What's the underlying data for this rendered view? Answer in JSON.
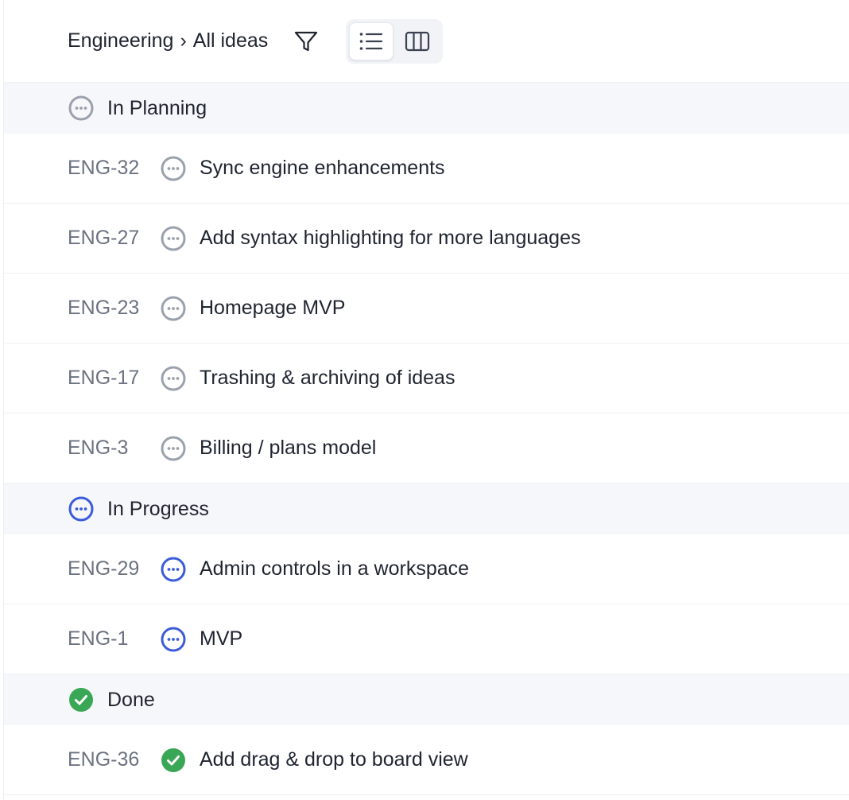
{
  "header": {
    "breadcrumb_team": "Engineering",
    "breadcrumb_sep": "›",
    "breadcrumb_view": "All ideas",
    "filter_icon": "filter-icon",
    "view_list_icon": "list-view-icon",
    "view_board_icon": "board-view-icon",
    "active_view": "list"
  },
  "colors": {
    "planning": "#9aa1ad",
    "progress": "#3b5bdb",
    "done": "#3aa757"
  },
  "groups": [
    {
      "label": "In Planning",
      "status": "planning",
      "items": [
        {
          "id": "ENG-32",
          "title": "Sync engine enhancements"
        },
        {
          "id": "ENG-27",
          "title": "Add syntax highlighting for more languages"
        },
        {
          "id": "ENG-23",
          "title": "Homepage MVP"
        },
        {
          "id": "ENG-17",
          "title": "Trashing & archiving of ideas"
        },
        {
          "id": "ENG-3",
          "title": "Billing / plans model"
        }
      ]
    },
    {
      "label": "In Progress",
      "status": "progress",
      "items": [
        {
          "id": "ENG-29",
          "title": "Admin controls in a workspace"
        },
        {
          "id": "ENG-1",
          "title": "MVP"
        }
      ]
    },
    {
      "label": "Done",
      "status": "done",
      "items": [
        {
          "id": "ENG-36",
          "title": "Add drag & drop to board view"
        }
      ]
    }
  ]
}
